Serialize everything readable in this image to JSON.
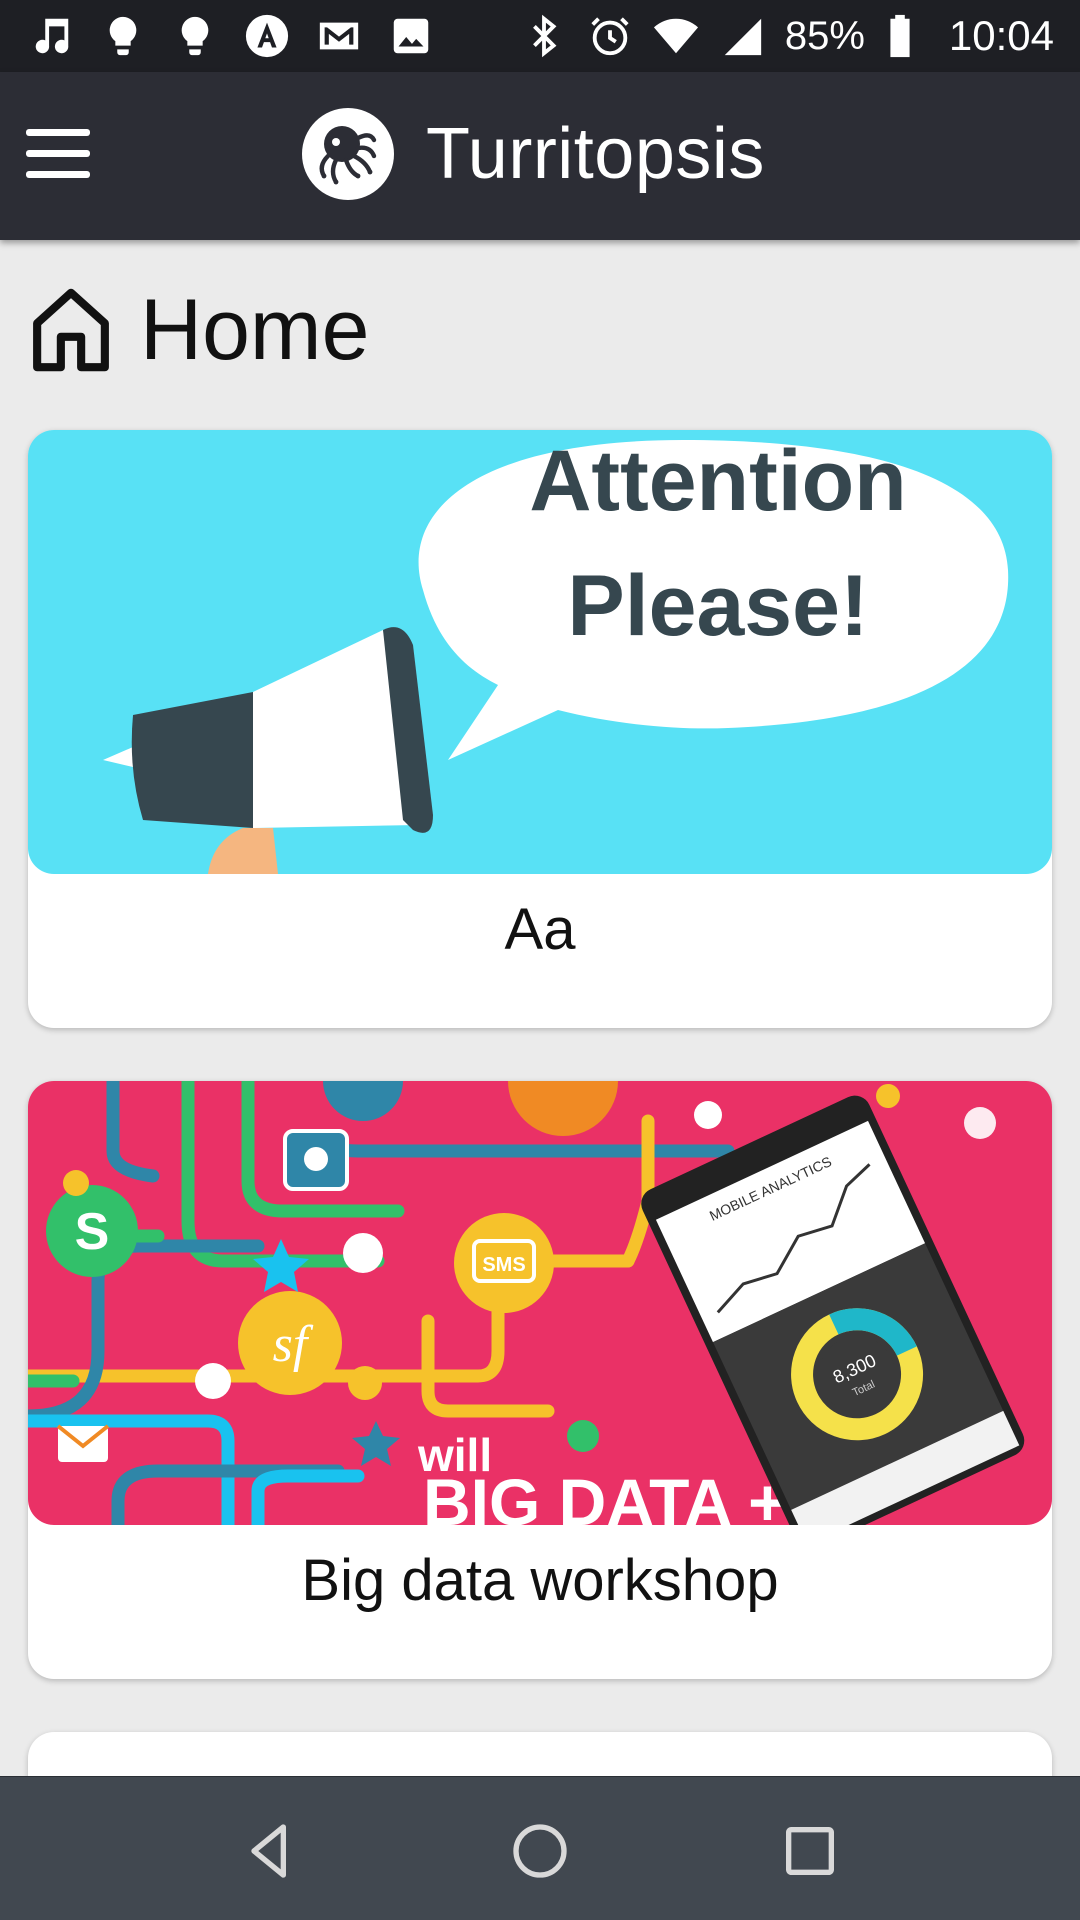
{
  "status_bar": {
    "battery": "85%",
    "time": "10:04",
    "left_icons": [
      "music-note-icon",
      "lightbulb-icon",
      "lightbulb-icon",
      "angular-icon",
      "gmail-icon",
      "image-icon"
    ],
    "right_icons": [
      "bluetooth-icon",
      "alarm-icon",
      "wifi-icon",
      "cell-signal-icon",
      "battery-icon"
    ]
  },
  "app_bar": {
    "title": "Turritopsis",
    "menu_icon": "hamburger-menu-icon",
    "logo_icon": "octopus-logo-icon",
    "background": "#2c2d35"
  },
  "page": {
    "title": "Home",
    "icon": "home-icon"
  },
  "cards": [
    {
      "caption": "Aa",
      "image_text": [
        "Attention",
        "Please!"
      ],
      "image_theme": "megaphone"
    },
    {
      "caption": "Big data workshop",
      "image_text": {
        "phone_header": "MOBILE ANALYTICS",
        "donut_value": "8,300",
        "donut_label": "Total",
        "bottom_text_1": "will",
        "bottom_text_2": "BIG DATA +",
        "sms": "SMS",
        "sf": "sf"
      },
      "image_theme": "infographic"
    },
    {
      "caption": ""
    }
  ],
  "nav_bar": {
    "back": "back-icon",
    "home": "home-circle-icon",
    "recent": "recent-apps-icon"
  },
  "colors": {
    "status_bar": "#1e1f24",
    "page_background": "#ebebeb",
    "card_1_bg": "#58e1f5",
    "card_2_bg": "#ea3166",
    "nav_bar": "#414850"
  }
}
